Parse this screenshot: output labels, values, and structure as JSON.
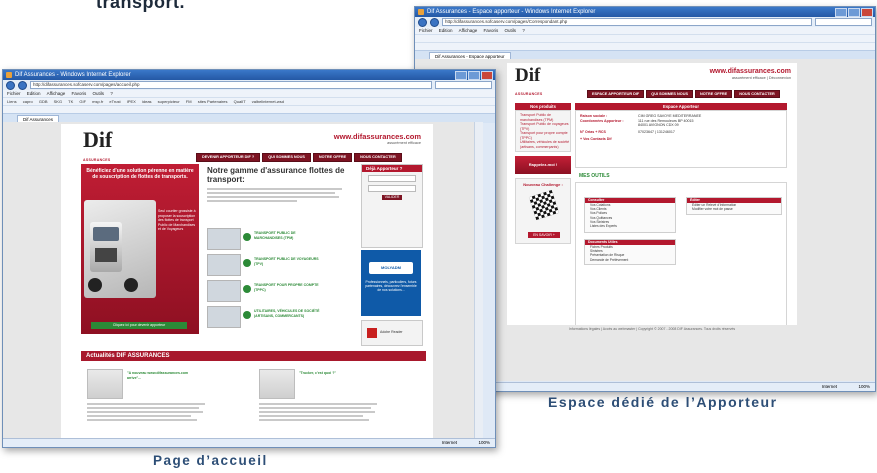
{
  "top_caption": "transport.",
  "captions": {
    "home": "Page d’accueil",
    "apporteur_space": "Espace dédié de l’Apporteur"
  },
  "left_window": {
    "title": "Dif Assurances - Windows Internet Explorer",
    "url": "http://difassurances.sofcaserv.com/pages/accueil.php",
    "menu": [
      "Fichier",
      "Edition",
      "Affichage",
      "Favoris",
      "Outils",
      "?"
    ],
    "links": [
      "Liens",
      "capro",
      "GDB",
      "SKG",
      "TK",
      "GIF",
      "msp.fr",
      "eTrust",
      "IPEX",
      "ideas",
      "superpicteur",
      "FM",
      "sites Partenaires",
      "QualIT",
      "valbelinternet-wsd"
    ],
    "tab": "Dif Assurances",
    "status_zone": "Internet",
    "status_zoom": "100%",
    "site": {
      "logo": "Dif",
      "logo_sub": "ASSURANCES",
      "domain": "www.difassurances.com",
      "tagline": "assurément efficace",
      "nav": [
        "DEVENIR APPORTEUR DIF ?",
        "QUI SOMMES NOUS",
        "NOTRE OFFRE",
        "NOUS CONTACTER"
      ],
      "hero_title": "Bénéficiez d'une solution pérenne en matière de souscription de flottes de transports.",
      "hero_side": "Seul courtier grossiste à proposer la souscription des flottes de transport Public de Marchandises et de Voyageurs",
      "hero_button": "Cliquez ici pour devenir apporteur",
      "main_title": "Notre gamme d'assurance flottes de transport:",
      "categories": [
        "TRANSPORT PUBLIC DE MARCHANDISES (TPM)",
        "TRANSPORT PUBLIC DE VOYAGEURS (TPV)",
        "TRANSPORT POUR PROPRE COMPTE (TPPC)",
        "UTILITAIRES, VÉHICULES DE SOCIÉTÉ (ARTISANS, COMMERCANTS)"
      ],
      "login_header": "Déjà Apporteur ?",
      "login_button": "VALIDER",
      "ad_brand": "MOLYADM",
      "ad_text": "Professionnels, particuliers, futurs partenaires, découvrez l'ensemble de nos solutions...",
      "pdf_label": "Adobe Reader",
      "news_header": "Actualités DIF ASSURANCES",
      "news_1": "\"A nouveau www.difassurances.com arrive\"...",
      "news_2": "\"Trucker, c'est quoi ?\""
    }
  },
  "right_window": {
    "title": "Dif Assurances - Espace apporteur - Windows Internet Explorer",
    "url": "http://difassurances.sofcaserv.com/pages/Correspondant.php",
    "menu": [
      "Fichier",
      "Edition",
      "Affichage",
      "Favoris",
      "Outils",
      "?"
    ],
    "tab": "Dif Assurances - Espace apporteur",
    "status_zone": "Internet",
    "status_zoom": "100%",
    "site": {
      "logo": "Dif",
      "logo_sub": "ASSURANCES",
      "domain": "www.difassurances.com",
      "tagline": "assurément efficace | Déconnexion",
      "nav": [
        "ESPACE APPORTEUR DIF",
        "QUI SOMMES NOUS",
        "NOTRE OFFRE",
        "NOUS CONTACTER"
      ],
      "products_header": "Nos produits",
      "products": [
        "Transport Public de marchandises (TPM)",
        "Transport Public de voyageurs (TPV)",
        "Transport pour propre compte (TPPC)",
        "Utilitaires, véhicules de société (artisans, commerçants)"
      ],
      "call_label": "Rappelez-moi !",
      "challenge_label": "Nouveau Challenge :",
      "learn_more": "EN SAVOIR +",
      "space_header": "Espace Apporteur",
      "fields": [
        {
          "key": "Raison sociale :",
          "value": "CIM GREG SAVOYE MEDITERRANEE"
        },
        {
          "key": "Coordonnées Apporteur :",
          "value": "111 rue des Remouleurs BP 40015 84001 AVIGNON CDX 09"
        },
        {
          "key": "N° Orias + RCS",
          "value": "07023647 | 131246017"
        }
      ],
      "contacts_link": "+ Vos Contacts Dif",
      "tools_title": "MES OUTILS",
      "consult_header": "Consulter",
      "consult_items": [
        "Vos Cotations",
        "Vos Clients",
        "Vos Polices",
        "Vos Quittances",
        "Vos Sinistres",
        "Listes des Experts"
      ],
      "edit_header": "Éditer",
      "edit_items": [
        "Éditer un Relevé d'Information",
        "Modifier votre mot de passe"
      ],
      "docs_header": "Documents Utiles",
      "docs_items": [
        "Fiches Produits",
        "Sinistres",
        "Présentation de Risque",
        "Demande de Prélèvement"
      ],
      "footer": "Informations légales | Accès au webmaster | Copyright © 2007 - 2008 DIF Assurances. Tous droits réservés"
    }
  }
}
